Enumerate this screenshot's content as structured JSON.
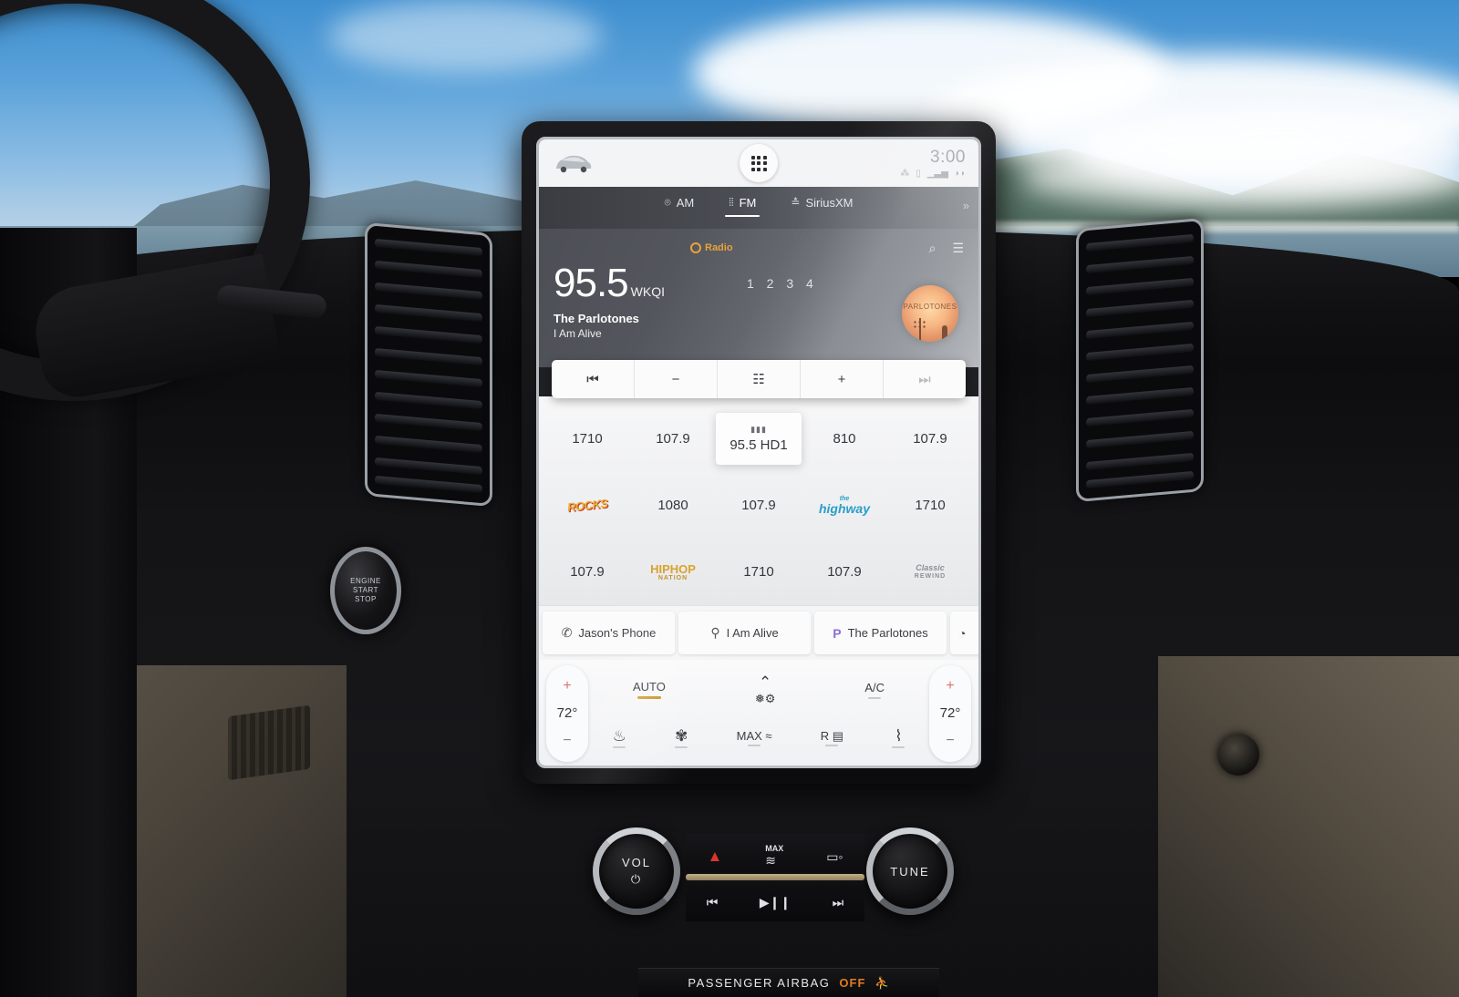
{
  "status_bar": {
    "car_icon": "car-icon",
    "apps_button": "apps-grid-icon",
    "clock": "3:00",
    "icons": [
      "bluetooth-icon",
      "battery-icon",
      "signal-icon",
      "wifi-icon"
    ]
  },
  "source_tabs": {
    "tabs": [
      {
        "label": "AM",
        "icon": "antenna-icon",
        "active": false
      },
      {
        "label": "FM",
        "icon": "broadcast-icon",
        "active": true
      },
      {
        "label": "SiriusXM",
        "icon": "satellite-icon",
        "active": false
      }
    ],
    "more_label": "»"
  },
  "now_playing": {
    "hd_badge": "Radio",
    "hd_channels": "1 2 3 4",
    "frequency": "95.5",
    "callsign": "WKQI",
    "artist": "The Parlotones",
    "track": "I Am Alive",
    "search_icon": "search-icon",
    "list_icon": "list-view-icon",
    "album_art_text": "PARLOTONES"
  },
  "transport": {
    "buttons": [
      {
        "label": "⏮",
        "name": "seek-down-button",
        "dim": false
      },
      {
        "label": "−",
        "name": "tune-down-button",
        "dim": false
      },
      {
        "label": "☷",
        "name": "presets-button",
        "dim": false
      },
      {
        "label": "+",
        "name": "tune-up-button",
        "dim": false
      },
      {
        "label": "⏭",
        "name": "seek-up-button",
        "dim": true
      }
    ]
  },
  "presets": {
    "rows": [
      [
        {
          "type": "text",
          "label": "1710"
        },
        {
          "type": "text",
          "label": "107.9"
        },
        {
          "type": "selected",
          "label": "95.5 HD1",
          "sub": "hd-icon"
        },
        {
          "type": "text",
          "label": "810"
        },
        {
          "type": "text",
          "label": "107.9"
        }
      ],
      [
        {
          "type": "logo-rocks",
          "label": "ROCKS"
        },
        {
          "type": "text",
          "label": "1080"
        },
        {
          "type": "text",
          "label": "107.9"
        },
        {
          "type": "logo-highway",
          "label": "highway",
          "sub": "the"
        },
        {
          "type": "text",
          "label": "1710"
        }
      ],
      [
        {
          "type": "text",
          "label": "107.9"
        },
        {
          "type": "logo-hiphop",
          "label": "HIPHOP",
          "sub": "NATION"
        },
        {
          "type": "text",
          "label": "1710"
        },
        {
          "type": "text",
          "label": "107.9"
        },
        {
          "type": "logo-classic",
          "label": "Classic",
          "sub": "REWIND"
        }
      ]
    ]
  },
  "shortcuts": {
    "items": [
      {
        "label": "Jason's Phone",
        "icon": "phone-icon"
      },
      {
        "label": "I Am Alive",
        "icon": "usb-icon"
      },
      {
        "label": "The Parlotones",
        "icon": "pandora-icon"
      }
    ],
    "partial_icon": "more-source-icon"
  },
  "climate": {
    "driver_temp": "72°",
    "passenger_temp": "72°",
    "plus": "+",
    "minus": "−",
    "top_row": [
      {
        "label": "AUTO",
        "name": "auto-climate-button",
        "active": true
      },
      {
        "label": "",
        "name": "airflow-mode-button",
        "glyph": "⌃",
        "active": false
      },
      {
        "label": "A/C",
        "name": "ac-button",
        "active": false
      }
    ],
    "bottom_row": [
      {
        "name": "heated-seat-driver-button",
        "glyph": "seat-heat-icon"
      },
      {
        "name": "fan-speed-button",
        "glyph": "fan-icon"
      },
      {
        "name": "max-defrost-button",
        "glyph": "MAX"
      },
      {
        "name": "rear-defrost-button",
        "glyph": "R"
      },
      {
        "name": "heated-seat-passenger-button",
        "glyph": "seat-icon"
      }
    ]
  },
  "physical_controls": {
    "volume_knob": "VOL",
    "volume_power_icon": "power-icon",
    "tune_knob": "TUNE",
    "hazard_icon": "hazard-triangle-icon",
    "max_defrost_label": "MAX",
    "defrost_icon": "defrost-icon",
    "media_icon": "media-display-icon",
    "prev_track": "⏮",
    "play_pause": "▶❙❙",
    "next_track": "⏭"
  },
  "airbag_indicator": {
    "label": "PASSENGER AIRBAG",
    "state": "OFF",
    "symbol": "airbag-off-icon"
  },
  "vehicle": {
    "start_button_line1": "ENGINE",
    "start_button_line2": "START",
    "start_button_line3": "STOP"
  },
  "colors": {
    "accent_amber": "#d8a33c",
    "hd_orange": "#e9a23b",
    "temp_plus_red": "#e0736a",
    "highway_blue": "#2a9ec9",
    "hazard_red": "#d9372c",
    "airbag_orange": "#e07a1f"
  }
}
